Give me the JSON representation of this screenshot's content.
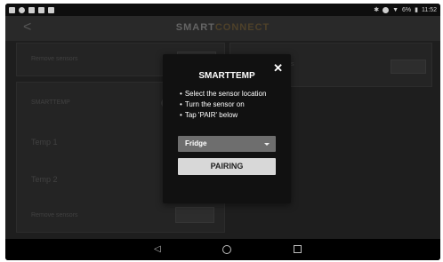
{
  "status_bar": {
    "battery": "6%",
    "time": "11:52"
  },
  "app_bar": {
    "back_symbol": "<",
    "brand_part1": "SMART",
    "brand_part2": "CONNECT"
  },
  "background": {
    "top_left_label": "Remove sensors",
    "right_label": "s",
    "group_title": "SMARTTEMP",
    "rows": [
      "Temp 1",
      "Temp 2"
    ],
    "bottom_label": "Remove sensors"
  },
  "dialog": {
    "title": "SMARTTEMP",
    "close_symbol": "✕",
    "instructions": [
      "Select the sensor location",
      "Turn the sensor on",
      "Tap 'PAIR' below"
    ],
    "location_selected": "Fridge",
    "pair_button_label": "PAIRING"
  },
  "nav_bar": {
    "back_symbol": "◁"
  }
}
